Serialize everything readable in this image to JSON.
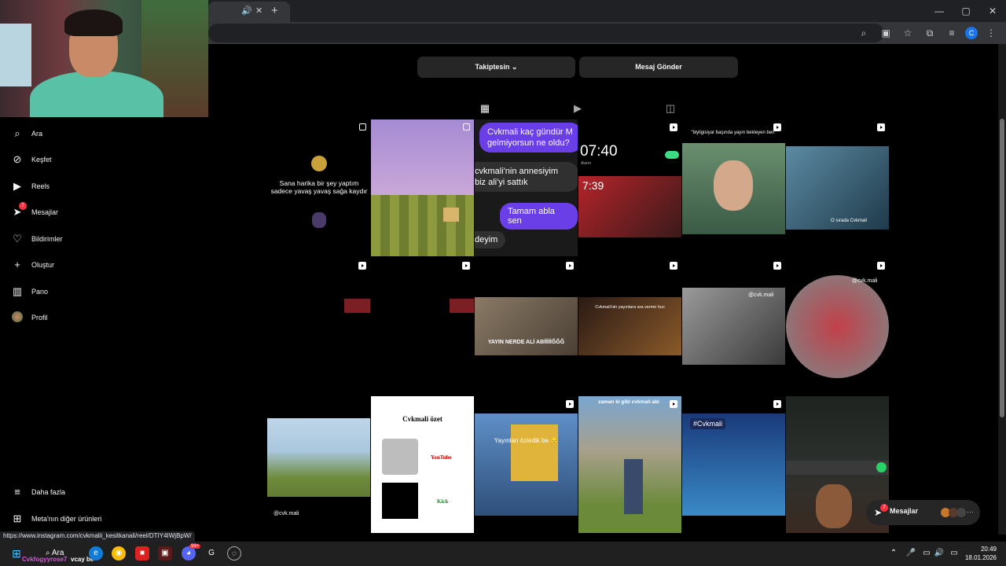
{
  "browser": {
    "tab_audio_icon": "speaker-icon",
    "tab_close": "✕",
    "new_tab": "+",
    "window_controls": [
      "—",
      "▢",
      "✕"
    ]
  },
  "sidebar": {
    "items": [
      {
        "label": "Ara",
        "icon": "search-icon"
      },
      {
        "label": "Keşfet",
        "icon": "compass-icon"
      },
      {
        "label": "Reels",
        "icon": "reels-icon"
      },
      {
        "label": "Mesajlar",
        "icon": "messenger-icon",
        "badge": "7"
      },
      {
        "label": "Bildirimler",
        "icon": "heart-icon"
      },
      {
        "label": "Oluştur",
        "icon": "plus-icon"
      },
      {
        "label": "Pano",
        "icon": "dashboard-icon"
      },
      {
        "label": "Profil",
        "icon": "avatar"
      }
    ],
    "more": "Daha fazla",
    "meta": "Meta'nın diğer ürünleri"
  },
  "profile": {
    "follow_button": "Takiptesin",
    "message_button": "Mesaj Gönder"
  },
  "grid": {
    "tile1_caption": "Sana harika bir şey yaptım sadece yavaş yavaş sağa kaydır",
    "chat_1": "Cvkmali kaç gündür M gelmiyorsun ne oldu?",
    "chat_2": "cvkmali'nin annesiyim biz ali'yi sattık",
    "chat_3": "Tamam abla sen",
    "chat_4": "deyim",
    "clock": "07:40",
    "clock_sub": "Alarm",
    "time2": "7:39",
    "tile5_caption": "\"biyligisiyar başında yayın bekleyen ben\"",
    "tile6_caption": "O sırada Cvkmali",
    "tile9_caption": "YAYIN NERDE ALİ ABİİİİİĞĞĞ",
    "tile10_caption": "Cvkmali'nin yayınlara ara verme hızı",
    "tile11_tag": "@cvk.mali",
    "tile12_tag": "@cvk.mali",
    "tile13_tag": "@cvk.mali",
    "summary_title": "Cvkmali özet",
    "summary_youtube": "YouTube",
    "summary_kick": "Kick",
    "tile15_caption": "Yayınları özledik be 😔",
    "tile16_caption": "zaman ki gibi cvkmali abi",
    "tile17_tag": "#Cvkmali"
  },
  "messages_pill": {
    "label": "Mesajlar",
    "badge": "7"
  },
  "status_url": "https://www.instagram.com/cvkmalii_kesitkanali/reel/DTIY4IWjBpW/",
  "taskbar": {
    "search": "Ara",
    "overlay_name": "Cvkfogyyrose7",
    "overlay_text": "vcay be",
    "time": "20:49",
    "date": "18.01.2026",
    "discord_badge": "99+"
  },
  "colors": {
    "accent_purple": "#6a3fe8",
    "button_bg": "#262626",
    "notification_red": "#ff3040"
  }
}
